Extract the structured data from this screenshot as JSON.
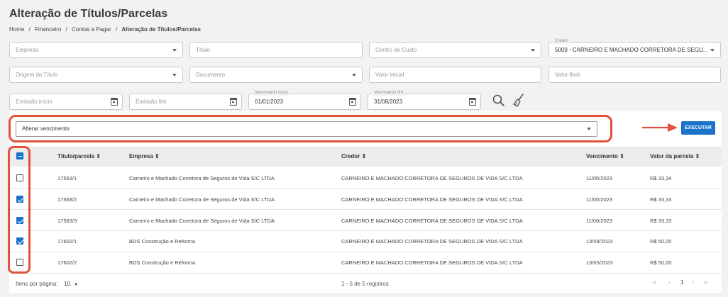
{
  "header": {
    "title": "Alteração de Títulos/Parcelas",
    "breadcrumb": [
      "Home",
      "/",
      "Financeiro",
      "/",
      "Contas a Pagar",
      "/",
      "Alteração de Títulos/Parcelas"
    ]
  },
  "filters": {
    "empresa": "Empresa",
    "titulo": "Título",
    "centro_custo": "Centro de Custo",
    "credor_label": "Credor",
    "credor_value": "5009 - CARNEIRO E MACHADO CORRETORA DE SEGU...",
    "origem": "Origem do Título",
    "documento": "Documento",
    "valor_inicial": "Valor inicial",
    "valor_final": "Valor final",
    "emissao_inicio": "Emissão início",
    "emissao_fim": "Emissão fim",
    "venc_inicio_label": "Vencimento início",
    "venc_inicio_value": "01/01/2023",
    "venc_fim_label": "Vencimento fim",
    "venc_fim_value": "31/08/2023"
  },
  "action": {
    "select_value": "Alterar vencimento",
    "execute_label": "EXECUTAR"
  },
  "table": {
    "columns": [
      "Título/parcela ⇕",
      "Empresa ⇕",
      "Credor ⇕",
      "Vencimento ⇕",
      "Valor da parcela ⇕"
    ],
    "rows": [
      {
        "titulo": "17563/1",
        "empresa": "Carneiro e Machado Corretora de Seguros de Vida S/C LTDA",
        "credor": "CARNEIRO E MACHADO CORRETORA DE SEGUROS DE VIDA S/C LTDA",
        "vencimento": "11/05/2023",
        "valor": "R$ 33,34",
        "checked": false
      },
      {
        "titulo": "17563/2",
        "empresa": "Carneiro e Machado Corretora de Seguros de Vida S/C LTDA",
        "credor": "CARNEIRO E MACHADO CORRETORA DE SEGUROS DE VIDA S/C LTDA",
        "vencimento": "11/05/2023",
        "valor": "R$ 33,33",
        "checked": true
      },
      {
        "titulo": "17563/3",
        "empresa": "Carneiro e Machado Corretora de Seguros de Vida S/C LTDA",
        "credor": "CARNEIRO E MACHADO CORRETORA DE SEGUROS DE VIDA S/C LTDA",
        "vencimento": "11/06/2023",
        "valor": "R$ 33,33",
        "checked": true
      },
      {
        "titulo": "17602/1",
        "empresa": "BDS Construção e Reforma",
        "credor": "CARNEIRO E MACHADO CORRETORA DE SEGUROS DE VIDA S/C LTDA",
        "vencimento": "13/04/2023",
        "valor": "R$ 50,00",
        "checked": true
      },
      {
        "titulo": "17602/2",
        "empresa": "BDS Construção e Reforma",
        "credor": "CARNEIRO E MACHADO CORRETORA DE SEGUROS DE VIDA S/C LTDA",
        "vencimento": "13/05/2023",
        "valor": "R$ 50,00",
        "checked": false
      }
    ]
  },
  "footer": {
    "per_page_label": "Itens por página:",
    "per_page_value": "10",
    "range": "1 - 5 de 5 registros",
    "page": "1",
    "first": "«",
    "prev": "‹",
    "next": "›",
    "last": "»"
  },
  "colors": {
    "accent": "#1a73c9",
    "highlight": "#e0523c"
  },
  "icons": [
    "search-icon",
    "broom-icon",
    "calendar-icon",
    "arrow-right-icon"
  ]
}
